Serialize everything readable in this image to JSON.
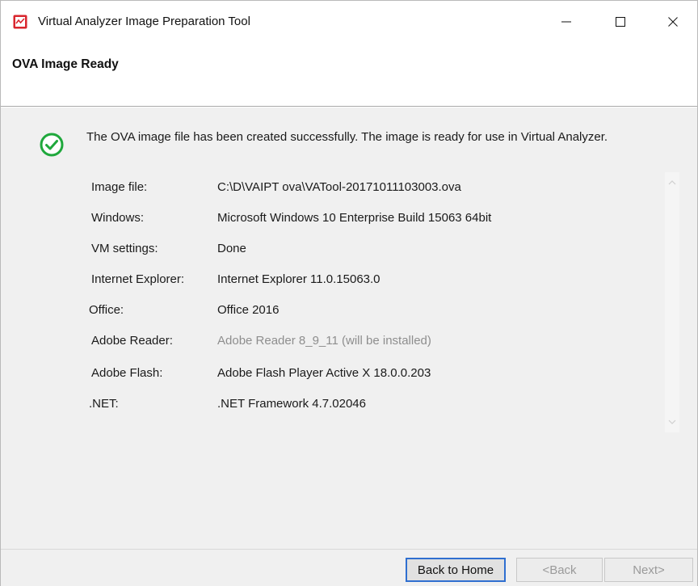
{
  "window": {
    "title": "Virtual Analyzer Image Preparation Tool"
  },
  "header": {
    "title": "OVA Image Ready"
  },
  "status": {
    "message": "The OVA image file has been created successfully. The image is ready for use in Virtual Analyzer.",
    "icon": "success-check-icon",
    "color": "#1fa83c"
  },
  "details": [
    {
      "label": "Image file:",
      "value": "C:\\D\\VAIPT ova\\VATool-20171011103003.ova",
      "muted": false
    },
    {
      "label": "Windows:",
      "value": "Microsoft Windows 10 Enterprise Build 15063 64bit",
      "muted": false
    },
    {
      "label": "VM settings:",
      "value": "Done",
      "muted": false
    },
    {
      "label": "Internet Explorer:",
      "value": "Internet Explorer 11.0.15063.0",
      "muted": false
    },
    {
      "label": "Office:",
      "value": "Office 2016",
      "muted": false
    },
    {
      "label": "Adobe Reader:",
      "value": "Adobe Reader 8_9_11 (will be installed)",
      "muted": true
    },
    {
      "label": "Adobe Flash:",
      "value": "Adobe Flash Player Active X 18.0.0.203",
      "muted": false
    },
    {
      "label": ".NET:",
      "value": ".NET Framework 4.7.02046",
      "muted": false
    }
  ],
  "footer": {
    "back_home_label": "Back to Home",
    "back_label": "<Back",
    "next_label": "Next>"
  },
  "colors": {
    "app_icon": "#d9262e",
    "accent_border": "#2f6fd0"
  }
}
